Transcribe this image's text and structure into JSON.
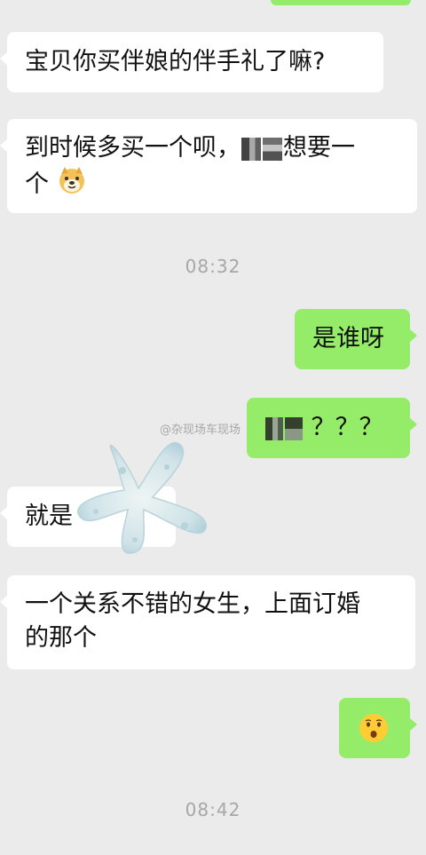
{
  "messages": [
    {
      "side": "in",
      "text": "宝贝你买伴娘的伴手礼了嘛?"
    },
    {
      "side": "in",
      "line1_before": "到时候多买一个呗，",
      "line1_after": "想要一",
      "line2": "个",
      "emoji": "doge-emoji"
    },
    {
      "side": "out",
      "text": "是谁呀"
    },
    {
      "side": "out",
      "text": "？？？"
    },
    {
      "side": "in",
      "text": "就是"
    },
    {
      "side": "in",
      "line1": "一个关系不错的女生，上面订婚",
      "line2": "的那个"
    },
    {
      "side": "out",
      "emoji": "hushed-face-emoji"
    }
  ],
  "timestamps": [
    "08:32",
    "08:42"
  ],
  "watermark": "@杂现场车现场",
  "colors": {
    "background": "#ebebeb",
    "incoming_bubble": "#ffffff",
    "outgoing_bubble": "#95ec69",
    "timestamp_text": "#a7a7a7"
  }
}
